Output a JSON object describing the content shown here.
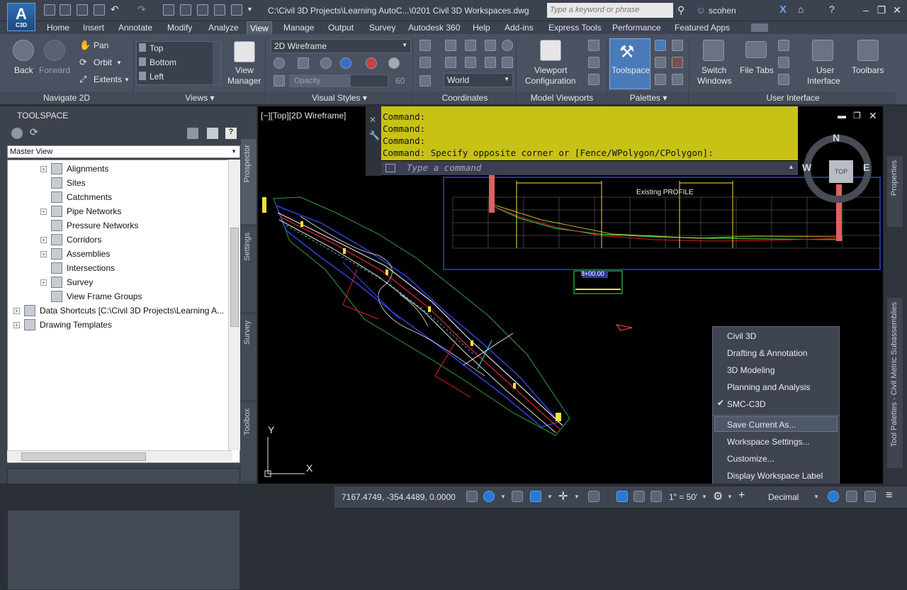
{
  "app": {
    "logo_big": "A",
    "logo_small": "C3D"
  },
  "title": "C:\\Civil 3D Projects\\Learning AutoC...\\0201 Civil 3D Workspaces.dwg",
  "search": {
    "placeholder": "Type a keyword or phrase"
  },
  "user": "scohen",
  "ribbon_tabs": [
    "Home",
    "Insert",
    "Annotate",
    "Modify",
    "Analyze",
    "View",
    "Manage",
    "Output",
    "Survey",
    "Autodesk 360",
    "Help",
    "Add-ins",
    "Express Tools",
    "Performance",
    "Featured Apps"
  ],
  "active_tab": "View",
  "navigate2d": {
    "back": "Back",
    "forward": "Forward",
    "pan": "Pan",
    "orbit": "Orbit",
    "extents": "Extents",
    "title": "Navigate 2D"
  },
  "views": {
    "items": [
      "Top",
      "Bottom",
      "Left"
    ],
    "manager_line1": "View",
    "manager_line2": "Manager",
    "title": "Views"
  },
  "visual_styles": {
    "current": "2D Wireframe",
    "opacity_label": "Opacity",
    "opacity_value": "60",
    "title": "Visual Styles"
  },
  "coordinates": {
    "ucs": "World",
    "title": "Coordinates"
  },
  "model_viewports": {
    "config_line1": "Viewport",
    "config_line2": "Configuration",
    "title": "Model Viewports"
  },
  "palettes": {
    "toolspace": "Toolspace",
    "title": "Palettes"
  },
  "user_interface": {
    "switch_line1": "Switch",
    "switch_line2": "Windows",
    "file_tabs": "File Tabs",
    "ui_line1": "User",
    "ui_line2": "Interface",
    "toolbars": "Toolbars",
    "title": "User Interface"
  },
  "toolspace": {
    "title": "TOOLSPACE",
    "view": "Master View",
    "tree": [
      {
        "label": "Alignments",
        "level": 2,
        "expand": "+"
      },
      {
        "label": "Sites",
        "level": 2,
        "expand": ""
      },
      {
        "label": "Catchments",
        "level": 2,
        "expand": ""
      },
      {
        "label": "Pipe Networks",
        "level": 2,
        "expand": "+"
      },
      {
        "label": "Pressure Networks",
        "level": 2,
        "expand": ""
      },
      {
        "label": "Corridors",
        "level": 2,
        "expand": "+"
      },
      {
        "label": "Assemblies",
        "level": 2,
        "expand": "+"
      },
      {
        "label": "Intersections",
        "level": 2,
        "expand": ""
      },
      {
        "label": "Survey",
        "level": 2,
        "expand": "+"
      },
      {
        "label": "View Frame Groups",
        "level": 2,
        "expand": ""
      },
      {
        "label": "Data Shortcuts [C:\\Civil 3D Projects\\Learning A...",
        "level": 1,
        "expand": "+"
      },
      {
        "label": "Drawing Templates",
        "level": 1,
        "expand": "+"
      }
    ],
    "side_tabs": [
      "Prospector",
      "Settings",
      "Survey",
      "Toolbox"
    ]
  },
  "drawing": {
    "viewport_label": "[−][Top][2D Wireframe]",
    "command_history": [
      "Command:",
      "Command:",
      "Command:",
      "Command:  Specify opposite corner or [Fence/WPolygon/CPolygon]:"
    ],
    "command_placeholder": "Type a command",
    "compass": {
      "n": "N",
      "s": "S",
      "e": "E",
      "w": "W",
      "top": "TOP"
    },
    "profile_label": "Existing PROFILE",
    "station_label": "8+00.00",
    "ucs_x": "X",
    "ucs_y": "Y"
  },
  "workspace_menu": {
    "items": [
      "Civil 3D",
      "Drafting & Annotation",
      "3D Modeling",
      "Planning and Analysis",
      "SMC-C3D"
    ],
    "checked": "SMC-C3D",
    "actions": [
      "Save Current As...",
      "Workspace Settings...",
      "Customize...",
      "Display Workspace Label"
    ]
  },
  "status": {
    "coords": "7167.4749, -354.4489, 0.0000",
    "scale": "1\" = 50'",
    "units": "Decimal"
  },
  "right_tabs": [
    "Properties",
    "Tool Palettes - Civil Metric Subassemblies"
  ],
  "colors": {
    "ribbon": "#4a5160",
    "command_bg": "#c8c216",
    "accent": "#2a77d4"
  }
}
